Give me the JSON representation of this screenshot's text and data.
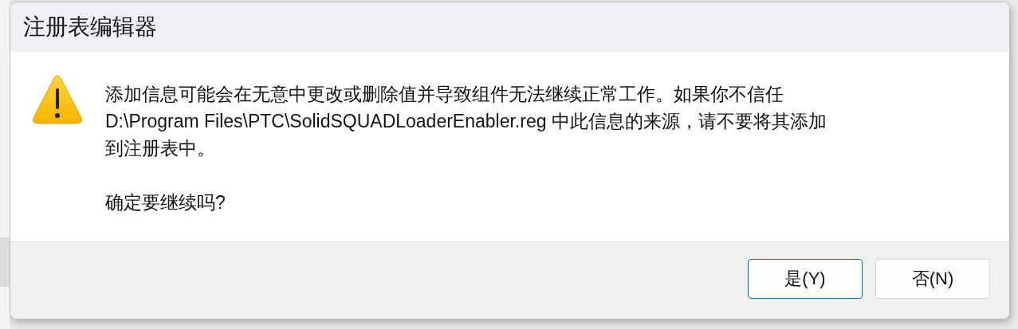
{
  "dialog": {
    "title": "注册表编辑器",
    "message_lines": [
      "添加信息可能会在无意中更改或删除值并导致组件无法继续正常工作。如果你不信任",
      "D:\\Program Files\\PTC\\SolidSQUADLoaderEnabler.reg 中此信息的来源，请不要将其添加",
      "到注册表中。"
    ],
    "question": "确定要继续吗?",
    "buttons": [
      {
        "label": "是(Y)",
        "selected": true
      },
      {
        "label": "否(N)",
        "selected": false
      }
    ]
  }
}
